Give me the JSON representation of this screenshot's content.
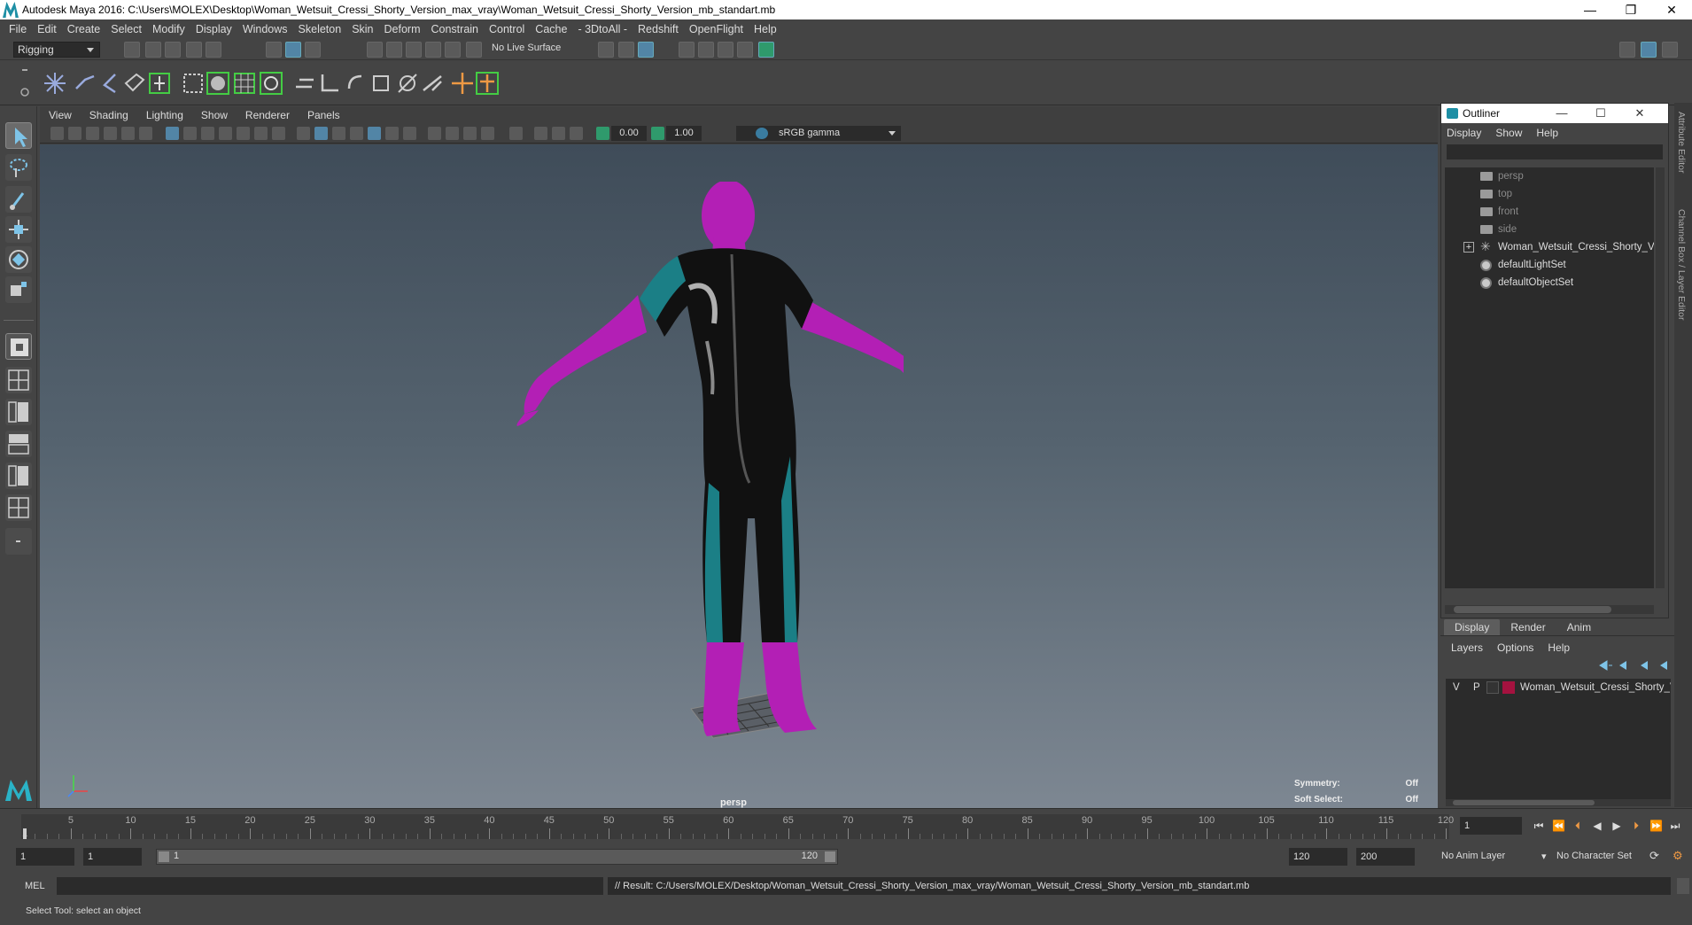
{
  "window": {
    "title": "Autodesk Maya 2016: C:\\Users\\MOLEX\\Desktop\\Woman_Wetsuit_Cressi_Shorty_Version_max_vray\\Woman_Wetsuit_Cressi_Shorty_Version_mb_standart.mb",
    "minimize": "—",
    "restore": "❐",
    "close": "✕"
  },
  "menu": [
    "File",
    "Edit",
    "Create",
    "Select",
    "Modify",
    "Display",
    "Windows",
    "Skeleton",
    "Skin",
    "Deform",
    "Constrain",
    "Control",
    "Cache",
    "- 3DtoAll -",
    "Redshift",
    "OpenFlight",
    "Help"
  ],
  "statusline": {
    "mode": "Rigging",
    "live_surface": "No Live Surface"
  },
  "panel": {
    "menu": [
      "View",
      "Shading",
      "Lighting",
      "Show",
      "Renderer",
      "Panels"
    ],
    "exposure": "0.00",
    "gamma_value": "1.00",
    "color_space": "sRGB gamma",
    "camera_label": "persp",
    "symmetry_label": "Symmetry:",
    "symmetry_value": "Off",
    "softselect_label": "Soft Select:",
    "softselect_value": "Off"
  },
  "outliner": {
    "title": "Outliner",
    "menu": [
      "Display",
      "Show",
      "Help"
    ],
    "items": [
      {
        "label": "persp",
        "icon": "camera-icon",
        "dim": true
      },
      {
        "label": "top",
        "icon": "camera-icon",
        "dim": true
      },
      {
        "label": "front",
        "icon": "camera-icon",
        "dim": true
      },
      {
        "label": "side",
        "icon": "camera-icon",
        "dim": true
      },
      {
        "label": "Woman_Wetsuit_Cressi_Shorty_Ver",
        "icon": "joint-icon",
        "dim": false
      },
      {
        "label": "defaultLightSet",
        "icon": "set-icon",
        "dim": false
      },
      {
        "label": "defaultObjectSet",
        "icon": "set-icon",
        "dim": false
      }
    ]
  },
  "layer_editor": {
    "tabs": [
      "Display",
      "Render",
      "Anim"
    ],
    "active_tab": "Display",
    "menu": [
      "Layers",
      "Options",
      "Help"
    ],
    "layer": {
      "v": "V",
      "p": "P",
      "name": "Woman_Wetsuit_Cressi_Shorty_V",
      "color": "#a4123f"
    }
  },
  "side_tabs": [
    "Attribute Editor",
    "Channel Box / Layer Editor"
  ],
  "timeline": {
    "ticks": [
      5,
      10,
      15,
      20,
      25,
      30,
      35,
      40,
      45,
      50,
      55,
      60,
      65,
      70,
      75,
      80,
      85,
      90,
      95,
      100,
      105,
      110,
      115,
      120
    ],
    "start_label": "1",
    "current_frame": "1"
  },
  "range": {
    "start": "1",
    "playback_start": "1",
    "slider_start": "1",
    "slider_end": "120",
    "playback_end": "120",
    "end": "200",
    "anim_layer": "No Anim Layer",
    "character_set": "No Character Set"
  },
  "command": {
    "lang": "MEL",
    "result": "// Result: C:/Users/MOLEX/Desktop/Woman_Wetsuit_Cressi_Shorty_Version_max_vray/Woman_Wetsuit_Cressi_Shorty_Version_mb_standart.mb"
  },
  "help_line": "Select Tool: select an object",
  "colors": {
    "wetsuit": "#111111",
    "accent": "#1b7f86",
    "skin": "#b31fb5",
    "layer": "#a4123f"
  }
}
